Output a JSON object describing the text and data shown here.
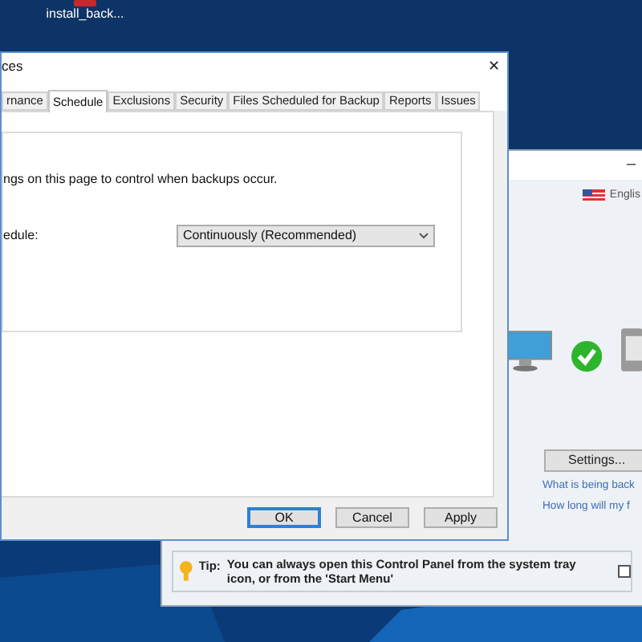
{
  "desktop_icon": {
    "label": "install_back..."
  },
  "back_window": {
    "minimize": "–",
    "language": "Englis",
    "settings_button": "Settings...",
    "links": [
      "What is being back",
      "How long will my f"
    ],
    "tip": {
      "label": "Tip:",
      "text": "You can always open this Control Panel from the system tray icon, or from the 'Start Menu'"
    },
    "tip_checkbox": {
      "checked": false
    }
  },
  "dialog": {
    "title": "ces",
    "close": "✕",
    "tabs": [
      {
        "label": "rnance",
        "selected": false
      },
      {
        "label": "Schedule",
        "selected": true
      },
      {
        "label": "Exclusions",
        "selected": false
      },
      {
        "label": "Security",
        "selected": false
      },
      {
        "label": "Files Scheduled for Backup",
        "selected": false
      },
      {
        "label": "Reports",
        "selected": false
      },
      {
        "label": "Issues",
        "selected": false
      }
    ],
    "description": "ngs on this page to control when backups occur.",
    "schedule_label": "edule:",
    "schedule_select": "Continuously (Recommended)",
    "buttons": [
      {
        "label": "OK",
        "default": true
      },
      {
        "label": "Cancel",
        "default": false
      },
      {
        "label": "Apply",
        "default": false
      }
    ]
  }
}
